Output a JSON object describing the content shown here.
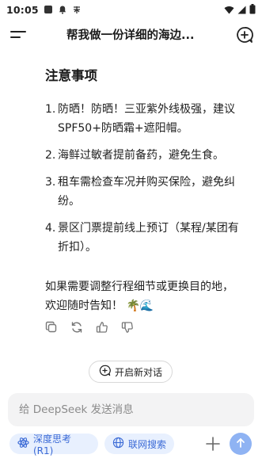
{
  "status_bar": {
    "time": "10:05",
    "icons": [
      "app-square-icon",
      "notification-bell-icon",
      "misc-app-icon",
      "wifi-icon",
      "signal-icon",
      "battery-icon"
    ]
  },
  "header": {
    "title": "帮我做一份详细的海边...",
    "menu_icon": "menu-icon",
    "new_chat_icon": "new-chat-plus-icon"
  },
  "content": {
    "section_title": "注意事项",
    "notes": [
      {
        "num": "1.",
        "text": "防晒！防晒！三亚紫外线极强，建议SPF50+防晒霜+遮阳帽。"
      },
      {
        "num": "2.",
        "text": "海鲜过敏者提前备药，避免生食。"
      },
      {
        "num": "3.",
        "text": "租车需检查车况并购买保险，避免纠纷。"
      },
      {
        "num": "4.",
        "text": "景区门票提前线上预订（某程/某团有折扣）。"
      }
    ],
    "closing": "如果需要调整行程细节或更换目的地，欢迎随时告知！ 🌴🌊"
  },
  "actions": [
    "copy-icon",
    "regenerate-icon",
    "thumbs-up-icon",
    "thumbs-down-icon"
  ],
  "new_chat_button": {
    "label": "开启新对话"
  },
  "composer": {
    "placeholder": "给 DeepSeek 发送消息",
    "value": ""
  },
  "toolbar": {
    "deep_think_label": "深度思考 (R1)",
    "web_search_label": "联网搜索"
  },
  "colors": {
    "accent": "#3b6ad6",
    "chip_bg": "#e8f0fe",
    "send_bg": "#8fb3f3"
  }
}
